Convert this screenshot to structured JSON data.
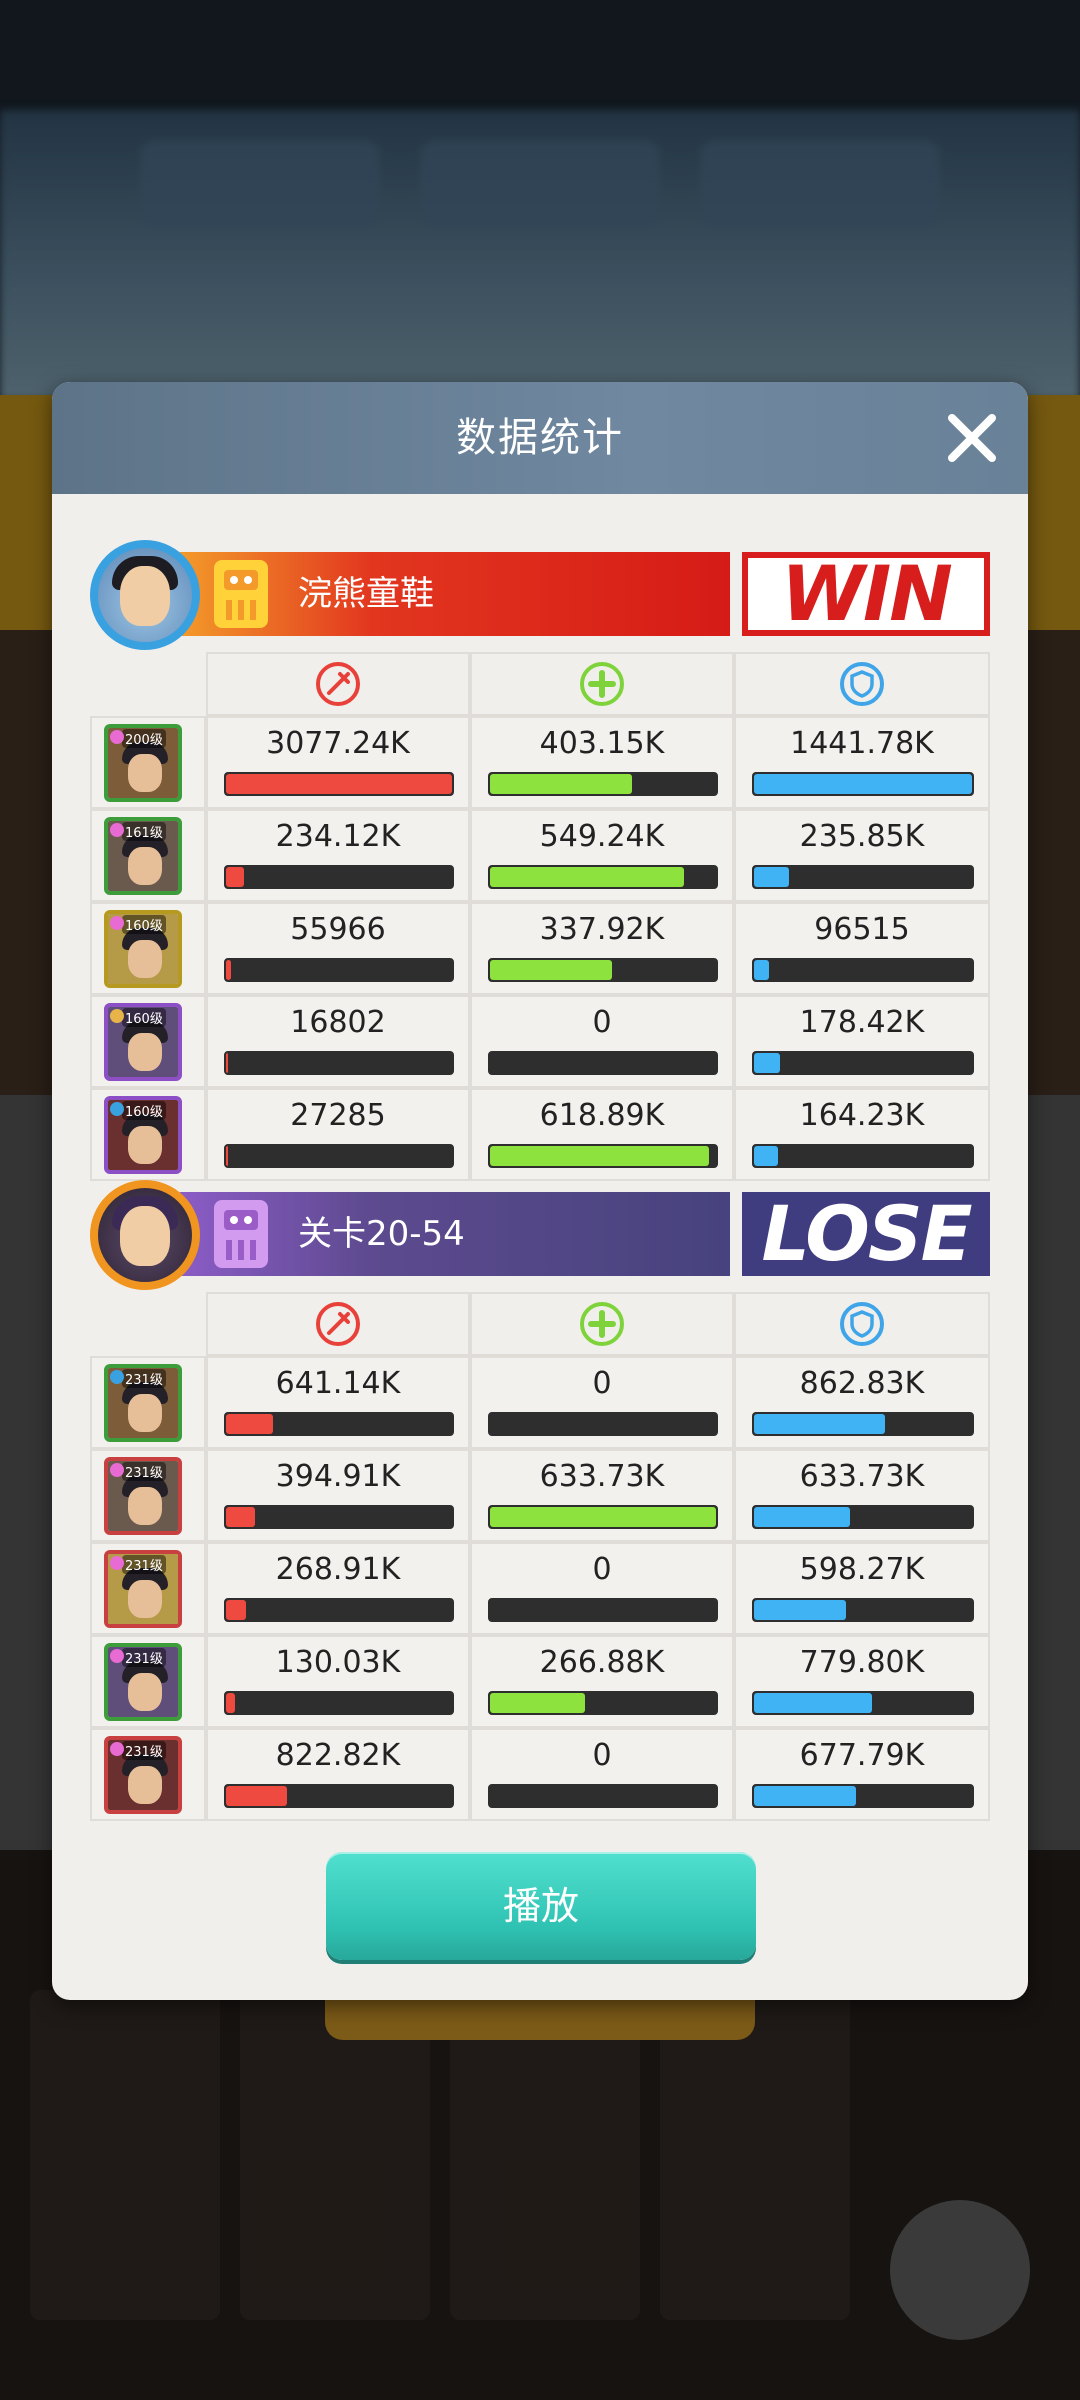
{
  "modal": {
    "title": "数据统计"
  },
  "teams": [
    {
      "name": "浣熊童鞋",
      "result": "WIN",
      "heroes": [
        {
          "level": "200级",
          "damage": "3077.24K",
          "heal": "403.15K",
          "shield": "1441.78K",
          "damage_pct": 100,
          "heal_pct": 63,
          "shield_pct": 100
        },
        {
          "level": "161级",
          "damage": "234.12K",
          "heal": "549.24K",
          "shield": "235.85K",
          "damage_pct": 8,
          "heal_pct": 86,
          "shield_pct": 16
        },
        {
          "level": "160级",
          "damage": "55966",
          "heal": "337.92K",
          "shield": "96515",
          "damage_pct": 2,
          "heal_pct": 54,
          "shield_pct": 7
        },
        {
          "level": "160级",
          "damage": "16802",
          "heal": "0",
          "shield": "178.42K",
          "damage_pct": 1,
          "heal_pct": 0,
          "shield_pct": 12
        },
        {
          "level": "160级",
          "damage": "27285",
          "heal": "618.89K",
          "shield": "164.23K",
          "damage_pct": 1,
          "heal_pct": 97,
          "shield_pct": 11
        }
      ]
    },
    {
      "name": "关卡20-54",
      "result": "LOSE",
      "heroes": [
        {
          "level": "231级",
          "damage": "641.14K",
          "heal": "0",
          "shield": "862.83K",
          "damage_pct": 21,
          "heal_pct": 0,
          "shield_pct": 60
        },
        {
          "level": "231级",
          "damage": "394.91K",
          "heal": "633.73K",
          "shield": "633.73K",
          "damage_pct": 13,
          "heal_pct": 100,
          "shield_pct": 44
        },
        {
          "level": "231级",
          "damage": "268.91K",
          "heal": "0",
          "shield": "598.27K",
          "damage_pct": 9,
          "heal_pct": 0,
          "shield_pct": 42
        },
        {
          "level": "231级",
          "damage": "130.03K",
          "heal": "266.88K",
          "shield": "779.80K",
          "damage_pct": 4,
          "heal_pct": 42,
          "shield_pct": 54
        },
        {
          "level": "231级",
          "damage": "822.82K",
          "heal": "0",
          "shield": "677.79K",
          "damage_pct": 27,
          "heal_pct": 0,
          "shield_pct": 47
        }
      ]
    }
  ],
  "play_button": {
    "label": "播放"
  },
  "colors": {
    "damage": "#ef4a3f",
    "heal": "#8ee23e",
    "shield": "#3fb3f4",
    "win": "#d81d1d",
    "lose": "#3f3c80"
  },
  "icons": {
    "close": "close-icon",
    "damage": "sword-icon",
    "heal": "plus-icon",
    "shield": "shield-icon"
  }
}
